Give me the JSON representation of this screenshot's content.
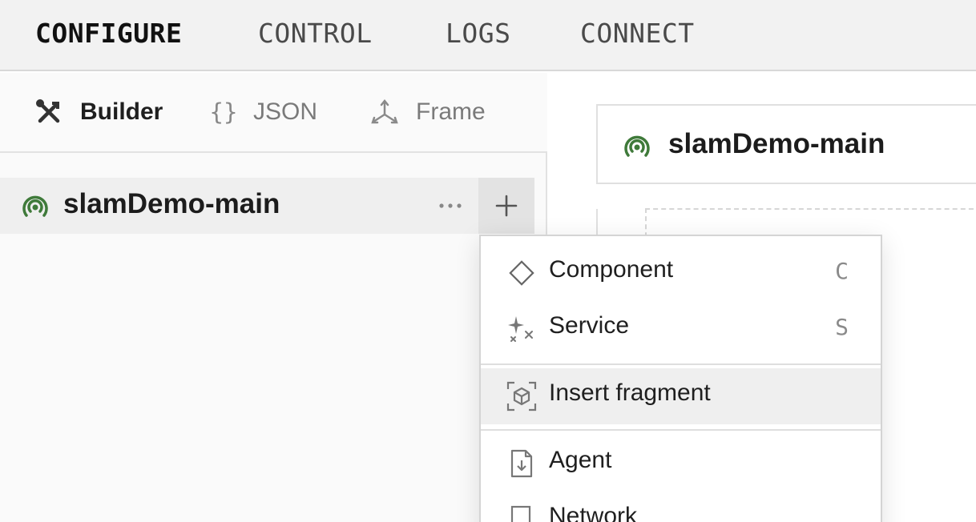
{
  "topnav": {
    "tabs": [
      {
        "label": "CONFIGURE",
        "active": true
      },
      {
        "label": "CONTROL",
        "active": false
      },
      {
        "label": "LOGS",
        "active": false
      },
      {
        "label": "CONNECT",
        "active": false
      }
    ]
  },
  "modes": {
    "builder": {
      "label": "Builder",
      "icon": "tools-icon",
      "active": true
    },
    "json": {
      "label": "JSON",
      "icon": "braces-icon",
      "glyph": "{}"
    },
    "frame": {
      "label": "Frame",
      "icon": "frame-axes-icon"
    }
  },
  "tree": {
    "robot_name": "slamDemo-main",
    "status_color": "#3f7a3a"
  },
  "main": {
    "robot_name": "slamDemo-main"
  },
  "add_menu": {
    "items": [
      {
        "label": "Component",
        "shortcut": "C",
        "icon": "diamond-icon"
      },
      {
        "label": "Service",
        "shortcut": "S",
        "icon": "sparkle-icon"
      },
      {
        "label": "Insert fragment",
        "shortcut": "",
        "icon": "fragment-icon"
      },
      {
        "label": "Agent",
        "shortcut": "",
        "icon": "file-download-icon"
      },
      {
        "label": "Network",
        "shortcut": "",
        "icon": "network-icon"
      }
    ]
  },
  "colors": {
    "accent_green": "#3f7a3a",
    "nav_bg": "#f2f2f2"
  }
}
